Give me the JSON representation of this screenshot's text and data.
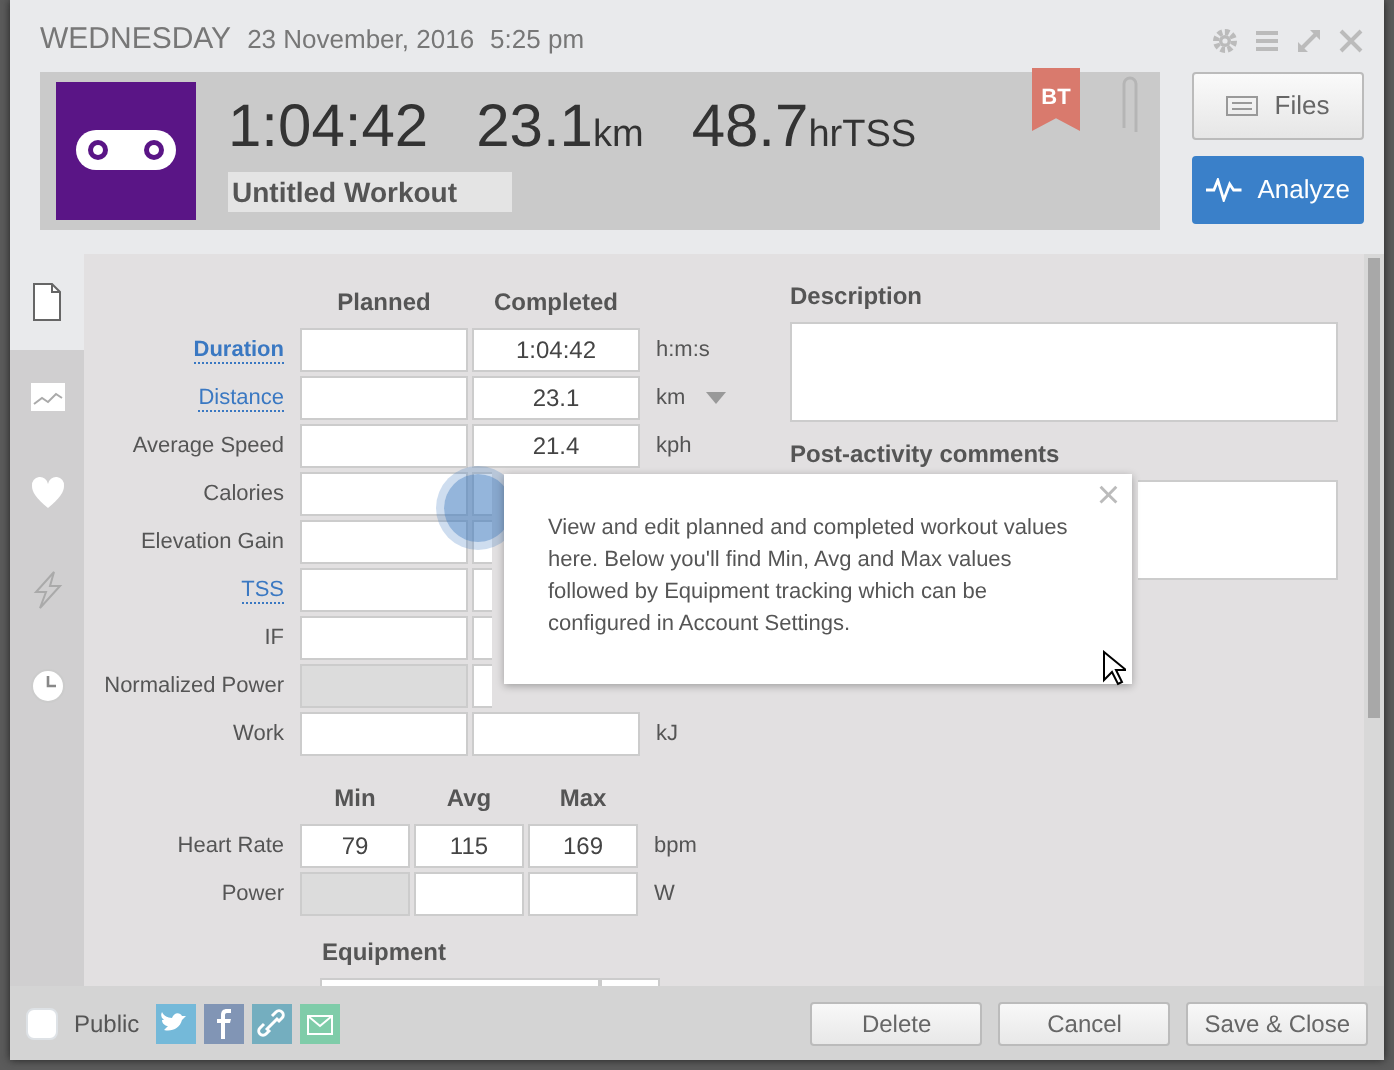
{
  "header": {
    "day": "WEDNESDAY",
    "date": "23 November, 2016",
    "time": "5:25 pm"
  },
  "summary": {
    "duration": "1:04:42",
    "distance": "23.1",
    "distance_unit": "km",
    "tss": "48.7",
    "tss_unit": "hrTSS",
    "title": "Untitled Workout",
    "badge": "BT"
  },
  "buttons": [
    {
      "label": "Files",
      "kind": "files"
    },
    {
      "label": "Analyze",
      "kind": "analyze"
    }
  ],
  "sidebar": [
    {
      "kind": "page",
      "selected": true
    },
    {
      "kind": "chart",
      "selected": false
    },
    {
      "kind": "heart",
      "selected": false
    },
    {
      "kind": "bolt",
      "selected": false
    },
    {
      "kind": "clock",
      "selected": false
    }
  ],
  "form": {
    "columns": [
      "Planned",
      "Completed"
    ],
    "rows": [
      {
        "label": "Duration",
        "kind": "primary-link",
        "completed": "1:04:42",
        "unit": "h:m:s",
        "disabled": false,
        "dropdown": false
      },
      {
        "label": "Distance",
        "kind": "link",
        "completed": "23.1",
        "unit": "km",
        "disabled": false,
        "dropdown": true
      },
      {
        "label": "Average Speed",
        "kind": "plain",
        "completed": "21.4",
        "unit": "kph",
        "disabled": false,
        "dropdown": false
      },
      {
        "label": "Calories",
        "kind": "plain",
        "disabled": false,
        "dropdown": false
      },
      {
        "label": "Elevation Gain",
        "kind": "plain",
        "disabled": false,
        "dropdown": false
      },
      {
        "label": "TSS",
        "kind": "link",
        "disabled": false,
        "dropdown": false
      },
      {
        "label": "IF",
        "kind": "plain",
        "disabled": false,
        "dropdown": false
      },
      {
        "label": "Normalized Power",
        "kind": "plain",
        "disabled": true,
        "dropdown": false
      },
      {
        "label": "Work",
        "kind": "plain",
        "unit": "kJ",
        "disabled": false,
        "dropdown": false
      }
    ]
  },
  "minmax": {
    "columns": [
      "Min",
      "Avg",
      "Max"
    ],
    "rows": [
      {
        "label": "Heart Rate",
        "values": [
          "79",
          "115",
          "169"
        ],
        "unit": "bpm",
        "disabled": false
      },
      {
        "label": "Power",
        "unit": "W",
        "disabled": true
      }
    ]
  },
  "equipment": {
    "title": "Equipment"
  },
  "description": {
    "label": "Description"
  },
  "comments": {
    "label": "Post-activity comments"
  },
  "tooltip": {
    "text": "View and edit planned and completed workout values here. Below you'll find Min, Avg and Max values followed by Equipment tracking which can be configured in Account Settings.",
    "close": "×"
  },
  "footer": {
    "public": {
      "label": "Public",
      "checked": false
    },
    "share": [
      {
        "kind": "twitter",
        "color": "#74b9d9"
      },
      {
        "kind": "facebook",
        "color": "#8195b5"
      },
      {
        "kind": "link",
        "color": "#74aebf"
      },
      {
        "kind": "mail",
        "color": "#7fcca9"
      }
    ],
    "buttons": [
      "Delete",
      "Cancel",
      "Save & Close"
    ]
  }
}
